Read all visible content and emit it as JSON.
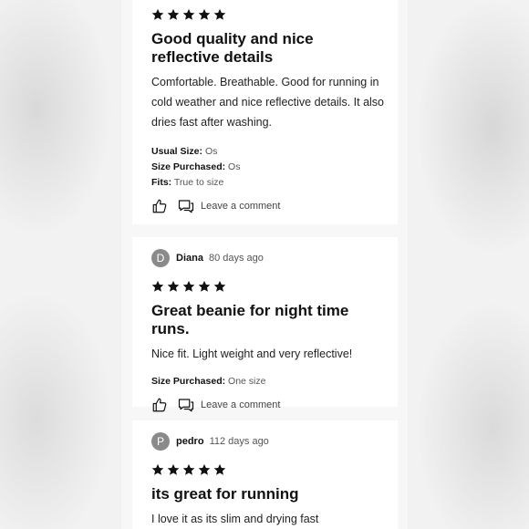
{
  "reviews": [
    {
      "rating": 5,
      "title": "Good quality and nice reflective details",
      "body": "Comfortable. Breathable. Good for running in cold weather and nice reflective details. It also dries fast after washing.",
      "details": [
        {
          "label": "Usual Size:",
          "value": "Os"
        },
        {
          "label": "Size Purchased:",
          "value": "Os"
        },
        {
          "label": "Fits:",
          "value": "True to size"
        }
      ],
      "comment_label": "Leave a comment"
    },
    {
      "initial": "D",
      "name": "Diana",
      "ago": "80 days ago",
      "rating": 5,
      "title": "Great beanie for night time runs.",
      "body": "Nice fit. Light weight and very reflective!",
      "details": [
        {
          "label": "Size Purchased:",
          "value": "One size"
        }
      ],
      "comment_label": "Leave a comment"
    },
    {
      "initial": "P",
      "name": "pedro",
      "ago": "112 days ago",
      "rating": 5,
      "title": "its great for running",
      "body": "I love it as its slim and drying fast"
    }
  ],
  "colors": {
    "star": "#111111",
    "avatar": "#8a8a8a",
    "card": "#ffffff"
  },
  "icons": {
    "like": "thumbs-up-icon",
    "comment": "comment-icon",
    "star": "star-icon"
  }
}
